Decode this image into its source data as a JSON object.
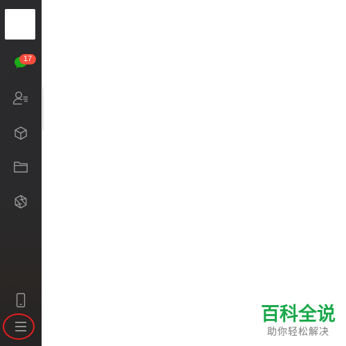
{
  "sidebar": {
    "chat_badge": "17",
    "icons": {
      "chat": "chat-bubble-icon",
      "contacts": "contacts-icon",
      "favorites": "cube-icon",
      "files": "folder-icon",
      "moments": "aperture-icon",
      "phone": "mobile-phone-icon",
      "menu": "hamburger-menu-icon"
    }
  },
  "watermark": {
    "title": "百科全说",
    "subtitle": "助你轻松解决"
  },
  "colors": {
    "sidebar_bg": "#2b2b2d",
    "icon_gray": "#9a9a9a",
    "chat_green": "#1aad19",
    "badge_red": "#f74c3c",
    "highlight_red": "#e61e1e",
    "watermark_green": "#1aa84a"
  }
}
